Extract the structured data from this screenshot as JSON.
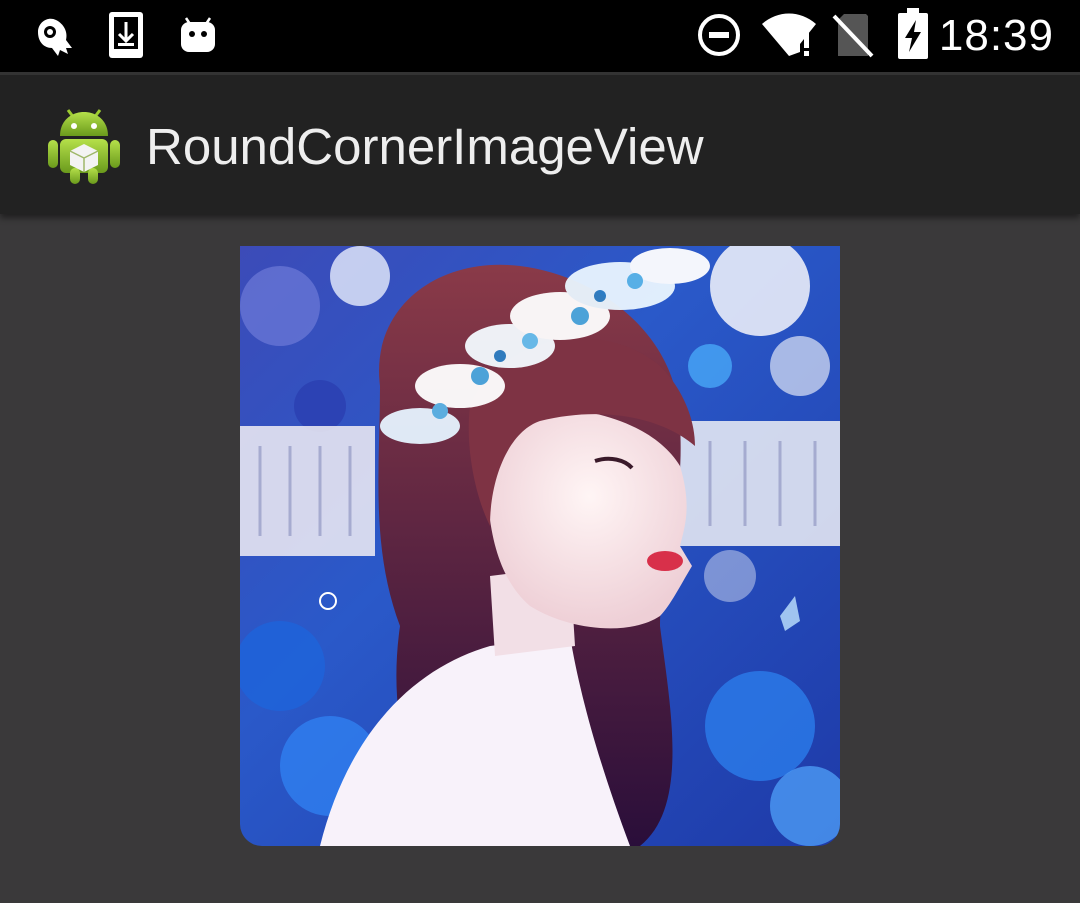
{
  "status_bar": {
    "time": "18:39",
    "left_icons": [
      "ghost-notification-icon",
      "download-icon",
      "android-debug-icon"
    ],
    "right_icons": [
      "do-not-disturb-icon",
      "wifi-no-internet-icon",
      "no-sim-icon",
      "battery-charging-icon"
    ]
  },
  "action_bar": {
    "title": "RoundCornerImageView",
    "icon": "android-app-icon"
  },
  "content": {
    "image": "round-corner-photo"
  }
}
